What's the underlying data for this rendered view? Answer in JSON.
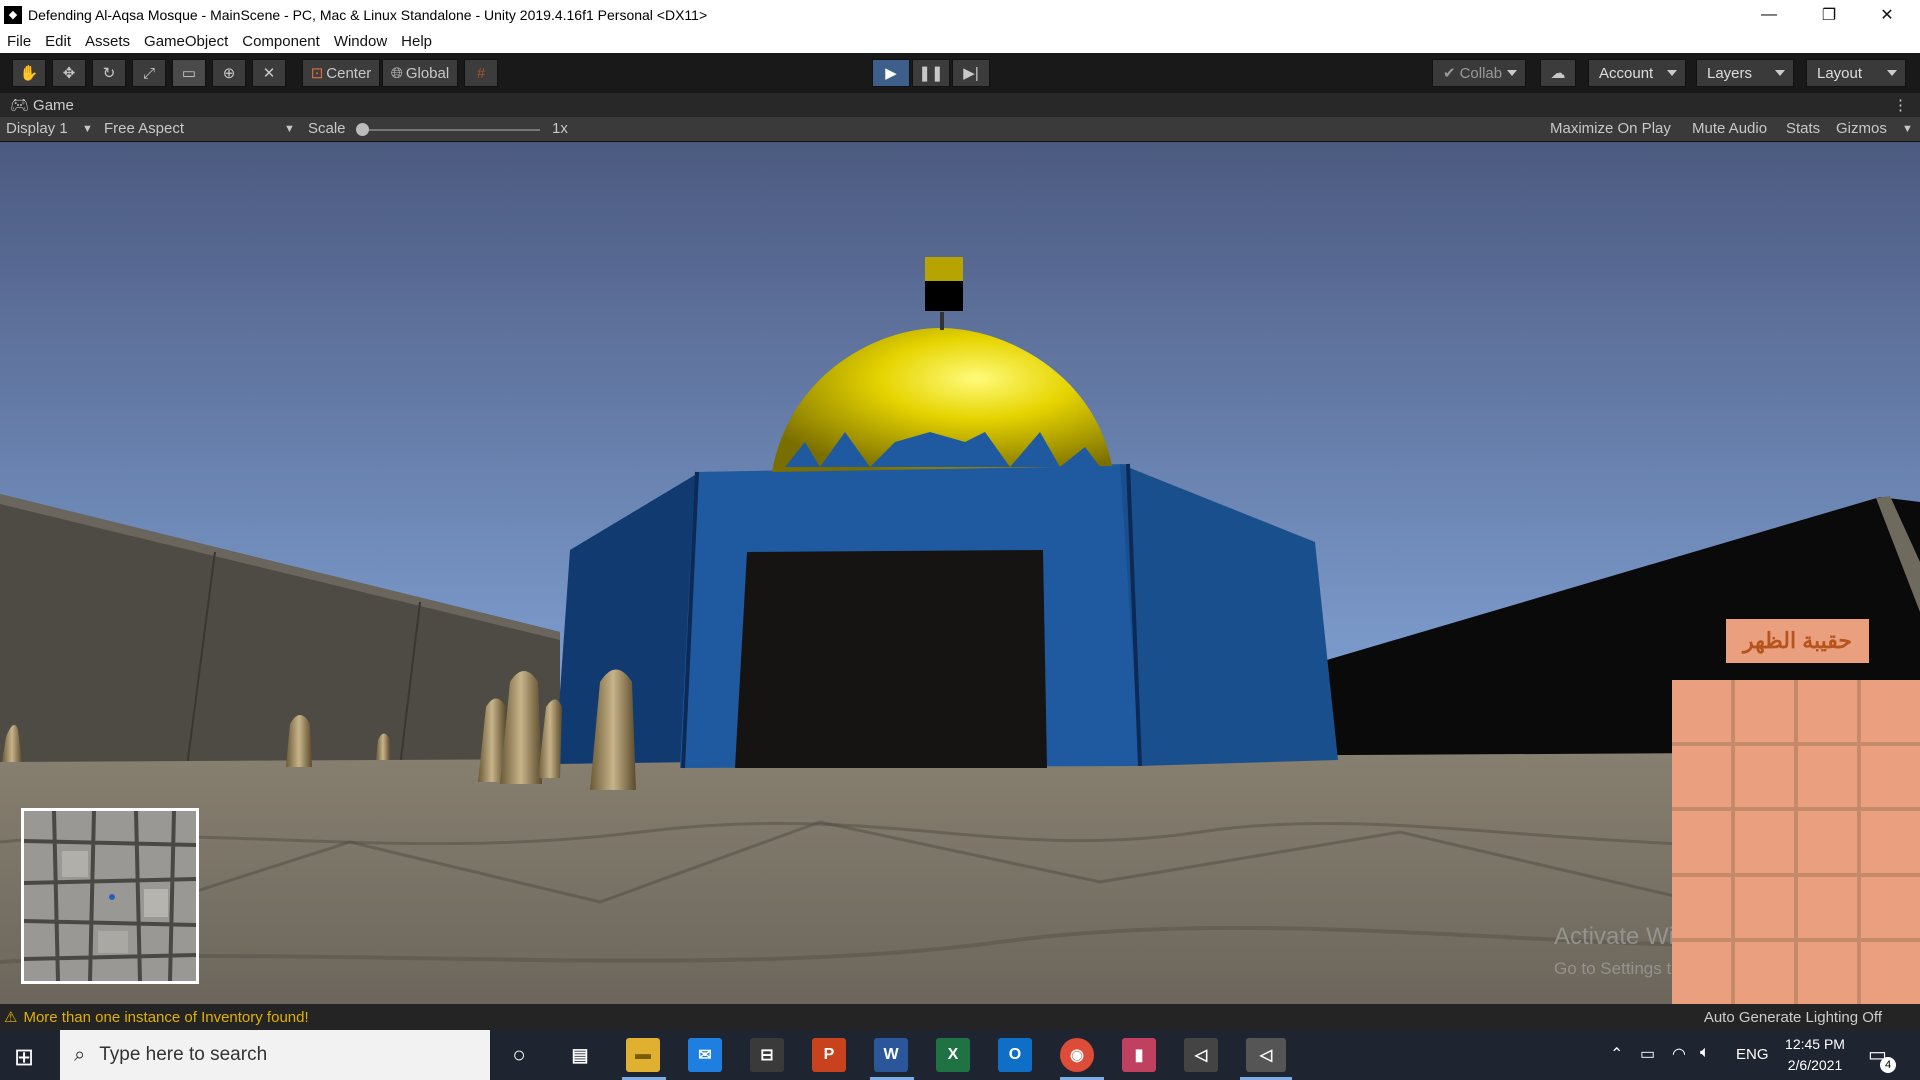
{
  "window": {
    "title": "Defending Al-Aqsa Mosque - MainScene - PC, Mac & Linux Standalone - Unity 2019.4.16f1 Personal <DX11>"
  },
  "menu": [
    "File",
    "Edit",
    "Assets",
    "GameObject",
    "Component",
    "Window",
    "Help"
  ],
  "toolbar": {
    "pivot": "Center",
    "space": "Global",
    "collab": "Collab",
    "account": "Account",
    "layers": "Layers",
    "layout": "Layout"
  },
  "game_view": {
    "tab": "Game",
    "display": "Display 1",
    "aspect": "Free Aspect",
    "scale_label": "Scale",
    "scale_value": "1x",
    "maximize": "Maximize On Play",
    "mute": "Mute Audio",
    "stats": "Stats",
    "gizmos": "Gizmos"
  },
  "hud": {
    "inventory_title": "حقيبة الظهر",
    "inventory_columns": 4,
    "inventory_rows": 5
  },
  "watermark": {
    "line1": "Activate Windows",
    "line2": "Go to Settings to activate Windows."
  },
  "status": {
    "warning": "More than one instance of Inventory found!",
    "lighting": "Auto Generate Lighting Off"
  },
  "taskbar": {
    "search_placeholder": "Type here to search",
    "lang": "ENG",
    "time": "12:45 PM",
    "date": "2/6/2021",
    "notifications": "4"
  },
  "colors": {
    "dome": "#e6d400",
    "building": "#1f5aa0",
    "inventory": "#eaa07e",
    "inventory_title": "#b5541c"
  }
}
